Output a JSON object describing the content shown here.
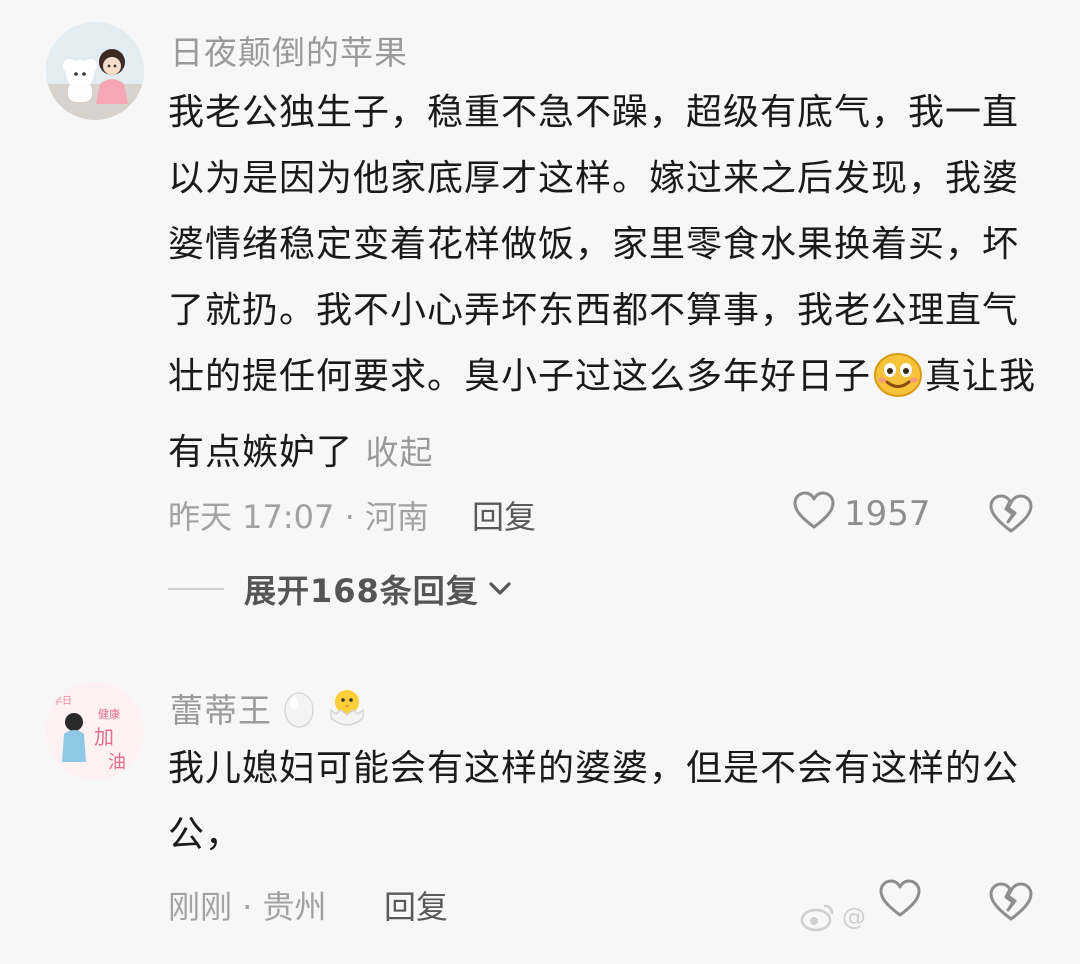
{
  "comments": [
    {
      "username": "日夜颠倒的苹果",
      "text_line1": "我老公独生子，稳重不急不躁，超级有底气，我一直以为是因为他家底厚才这样。嫁过来之后发现，我婆婆情绪稳定变着花样做饭，家里零食水果换着买，坏了就扔。我不小心弄坏东西都不算事，我老公理直气壮的提任何要求。臭小子过这么多年好日子",
      "text_line2": "真让我有点嫉妒了",
      "collapse": "收起",
      "time_location": "昨天 17:07 · 河南",
      "reply": "回复",
      "likes": "1957",
      "expand_replies": "展开168条回复"
    },
    {
      "username": "蕾蒂王",
      "text": "我儿媳妇可能会有这样的婆婆，但是不会有这样的公公，",
      "time_location": "刚刚 · 贵州",
      "reply": "回复",
      "likes": ""
    }
  ],
  "icons": {
    "like": "heart-outline-icon",
    "dislike": "broken-heart-icon",
    "chevron": "chevron-down-icon",
    "badge_egg": "egg-icon",
    "badge_chick": "hatching-chick-icon",
    "emoji": "smiling-face-emoji"
  },
  "watermark": "@",
  "colors": {
    "background": "#f7f7f7",
    "text": "#1a1a1a",
    "muted": "#9a9a9a"
  }
}
